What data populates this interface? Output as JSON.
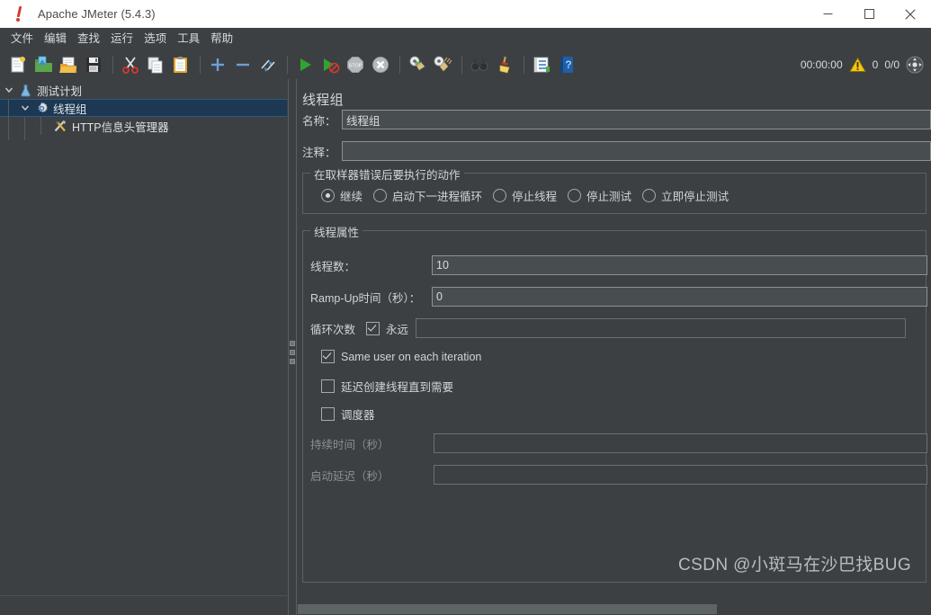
{
  "window": {
    "title": "Apache JMeter (5.4.3)",
    "app_icon": "jmeter-feather-icon",
    "minimize_label": "Minimize",
    "maximize_label": "Maximize",
    "close_label": "Close"
  },
  "menubar": {
    "items": [
      {
        "label": "文件",
        "name": "menu-file"
      },
      {
        "label": "编辑",
        "name": "menu-edit"
      },
      {
        "label": "查找",
        "name": "menu-search"
      },
      {
        "label": "运行",
        "name": "menu-run"
      },
      {
        "label": "选项",
        "name": "menu-options"
      },
      {
        "label": "工具",
        "name": "menu-tools"
      },
      {
        "label": "帮助",
        "name": "menu-help"
      }
    ]
  },
  "toolbar": {
    "buttons": [
      {
        "name": "new-test-plan-icon",
        "title": "新建"
      },
      {
        "name": "templates-icon",
        "title": "模板"
      },
      {
        "name": "open-icon",
        "title": "打开"
      },
      {
        "name": "save-icon",
        "title": "保存"
      },
      {
        "name": "cut-icon",
        "title": "剪切"
      },
      {
        "name": "copy-icon",
        "title": "复制"
      },
      {
        "name": "paste-icon",
        "title": "粘贴"
      },
      {
        "name": "expand-all-icon",
        "title": "展开全部"
      },
      {
        "name": "collapse-all-icon",
        "title": "折叠全部"
      },
      {
        "name": "toggle-icon",
        "title": "切换"
      },
      {
        "name": "start-icon",
        "title": "启动"
      },
      {
        "name": "start-no-pauses-icon",
        "title": "无暂停启动"
      },
      {
        "name": "stop-icon",
        "title": "停止"
      },
      {
        "name": "shutdown-icon",
        "title": "关闭"
      },
      {
        "name": "clear-icon",
        "title": "清除"
      },
      {
        "name": "clear-all-icon",
        "title": "清除全部"
      },
      {
        "name": "search-icon",
        "title": "查找"
      },
      {
        "name": "reset-search-icon",
        "title": "重置查找"
      },
      {
        "name": "function-helper-icon",
        "title": "函数助手对话框"
      },
      {
        "name": "help-icon",
        "title": "帮助"
      }
    ],
    "status": {
      "elapsed_time": "00:00:00",
      "warning_icon": "warning-triangle-icon",
      "error_count": "0",
      "threads": "0/0",
      "connect_icon": "remote-status-icon"
    }
  },
  "tree": {
    "nodes": [
      {
        "label": "测试计划",
        "icon": "test-plan-icon",
        "depth": 0,
        "expanded": true,
        "selected": false,
        "name": "tree-node-test-plan"
      },
      {
        "label": "线程组",
        "icon": "thread-group-gear-icon",
        "depth": 1,
        "expanded": true,
        "selected": true,
        "name": "tree-node-thread-group"
      },
      {
        "label": "HTTP信息头管理器",
        "icon": "http-header-manager-icon",
        "depth": 2,
        "expanded": false,
        "selected": false,
        "name": "tree-node-http-header-manager"
      }
    ]
  },
  "main": {
    "panel_title": "线程组",
    "name_field": {
      "label": "名称：",
      "value": "线程组",
      "placeholder": ""
    },
    "comment_field": {
      "label": "注释：",
      "value": "",
      "placeholder": ""
    },
    "error_action_group": {
      "title": "在取样器错误后要执行的动作",
      "options": [
        {
          "label": "继续",
          "selected": true,
          "name": "radio-continue"
        },
        {
          "label": "启动下一进程循环",
          "selected": false,
          "name": "radio-start-next-loop"
        },
        {
          "label": "停止线程",
          "selected": false,
          "name": "radio-stop-thread"
        },
        {
          "label": "停止测试",
          "selected": false,
          "name": "radio-stop-test"
        },
        {
          "label": "立即停止测试",
          "selected": false,
          "name": "radio-stop-test-now"
        }
      ]
    },
    "thread_properties_group": {
      "title": "线程属性",
      "thread_count": {
        "label": "线程数：",
        "value": "10"
      },
      "ramp_up": {
        "label": "Ramp-Up时间（秒）：",
        "value": "0"
      },
      "loop_count": {
        "label": "循环次数",
        "forever_label": "永远",
        "forever_checked": true,
        "value": "",
        "enabled": false
      },
      "same_user": {
        "label": "Same user on each iteration",
        "checked": true
      },
      "delayed_start": {
        "label": "延迟创建线程直到需要",
        "checked": false
      },
      "scheduler": {
        "label": "调度器",
        "checked": false
      },
      "duration": {
        "label": "持续时间（秒）",
        "value": "",
        "enabled": false
      },
      "startup_delay": {
        "label": "启动延迟（秒）",
        "value": "",
        "enabled": false
      }
    }
  },
  "watermark": {
    "text": "CSDN @小斑马在沙巴找BUG"
  },
  "colors": {
    "background": "#3c4043",
    "panel_border": "#5d6265",
    "text": "#d2d4d6",
    "text_dim": "#8b8f92",
    "selection": "#1d3853",
    "selection_border": "#2e5a80",
    "input_bg": "#484d50",
    "input_border": "#8d9194",
    "titlebar_bg": "#ffffff",
    "scrollbar_thumb": "#5e6366"
  }
}
